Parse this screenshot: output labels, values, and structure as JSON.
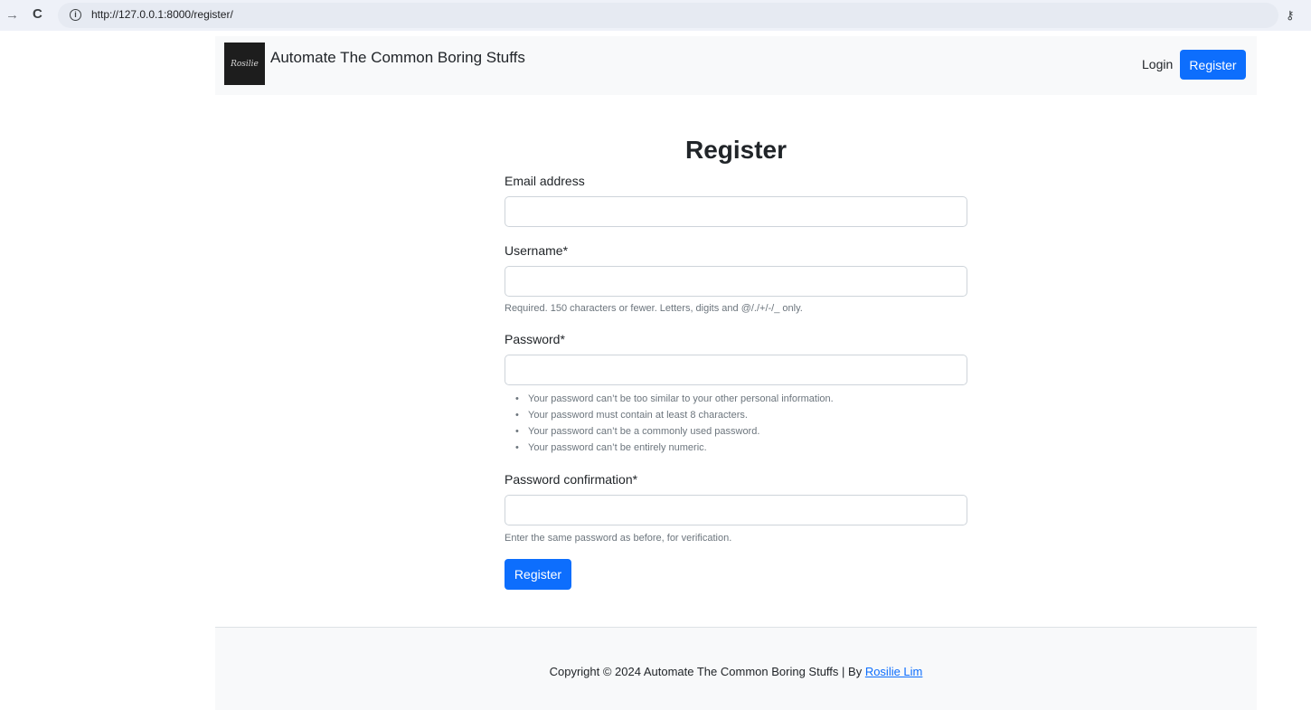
{
  "browser": {
    "url": "http://127.0.0.1:8000/register/",
    "forward_icon": "→",
    "reload_icon": "C",
    "info_icon": "i",
    "key_icon": "⚷"
  },
  "navbar": {
    "logo_text": "Rosilie",
    "brand": "Automate The Common Boring Stuffs",
    "login": "Login",
    "register": "Register",
    "accent": "#0d6efd"
  },
  "form": {
    "title": "Register",
    "email_label": "Email address",
    "email_value": "",
    "username_label": "Username*",
    "username_value": "",
    "username_help": "Required. 150 characters or fewer. Letters, digits and @/./+/-/_ only.",
    "password_label": "Password*",
    "password_value": "",
    "password_rules": [
      "Your password can’t be too similar to your other personal information.",
      "Your password must contain at least 8 characters.",
      "Your password can’t be a commonly used password.",
      "Your password can’t be entirely numeric."
    ],
    "confirm_label": "Password confirmation*",
    "confirm_value": "",
    "confirm_help": "Enter the same password as before, for verification.",
    "submit": "Register"
  },
  "footer": {
    "text": "Copyright © 2024 Automate The Common Boring Stuffs | By ",
    "author": "Rosilie Lim"
  }
}
